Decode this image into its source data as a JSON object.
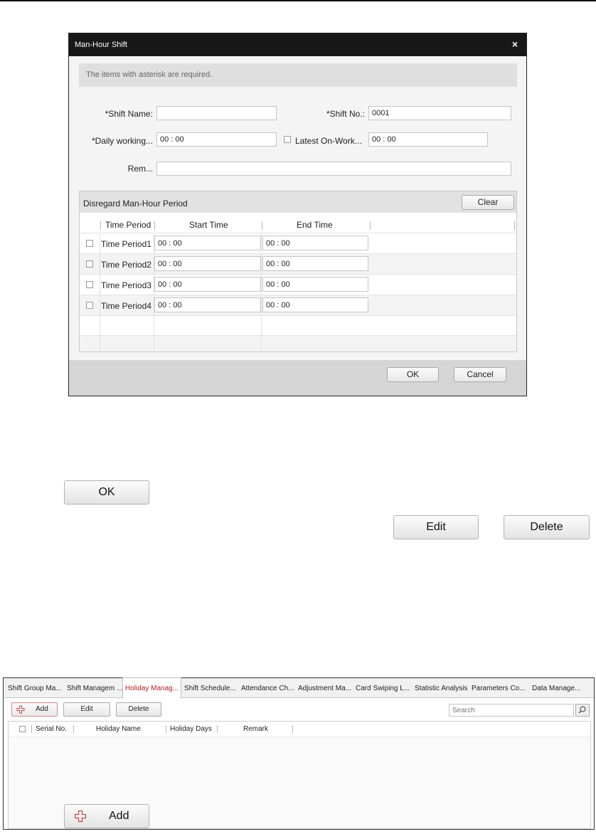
{
  "dialog": {
    "title": "Man-Hour Shift",
    "close_glyph": "×",
    "required_note": "The items with asterisk are required.",
    "shift_name_label": "*Shift Name:",
    "shift_name_value": "",
    "shift_no_label": "*Shift No.:",
    "shift_no_value": "0001",
    "daily_working_label": "*Daily working...",
    "daily_working_value": "00 : 00",
    "latest_on_work_label": "Latest On-Work...",
    "latest_on_work_value": "00 : 00",
    "remark_label": "Rem...",
    "remark_value": "",
    "period_title": "Disregard Man-Hour Period",
    "clear_label": "Clear",
    "columns": [
      "Time Period",
      "Start Time",
      "End Time"
    ],
    "rows": [
      {
        "name": "Time Period1",
        "start": "00 : 00",
        "end": "00 : 00"
      },
      {
        "name": "Time Period2",
        "start": "00 : 00",
        "end": "00 : 00"
      },
      {
        "name": "Time Period3",
        "start": "00 : 00",
        "end": "00 : 00"
      },
      {
        "name": "Time Period4",
        "start": "00 : 00",
        "end": "00 : 00"
      }
    ],
    "ok_label": "OK",
    "cancel_label": "Cancel"
  },
  "standalone_buttons": {
    "ok": "OK",
    "edit": "Edit",
    "delete": "Delete",
    "add": "Add"
  },
  "holiday_panel": {
    "tabs": [
      "Shift Group Ma...",
      "Shift Managem ...",
      "Holiday Manag...",
      "Shift Schedule...",
      "Attendance Ch...",
      "Adjustment Ma...",
      "Card Swiping L...",
      "Statistic Analysis",
      "Parameters Co...",
      "Data Manage..."
    ],
    "active_tab": "Holiday Manag...",
    "add_label": "Add",
    "edit_label": "Edit",
    "delete_label": "Delete",
    "search_placeholder": "Search",
    "columns": [
      "Serial No.",
      "Holiday Name",
      "Holiday Days",
      "Remark"
    ]
  },
  "colors": {
    "title_bar": "#181818",
    "active_tab_text": "#b32121",
    "add_icon": "#c94a4a"
  },
  "icons": [
    "close-icon",
    "plus-cross-icon",
    "search-icon",
    "checkbox-icon"
  ]
}
